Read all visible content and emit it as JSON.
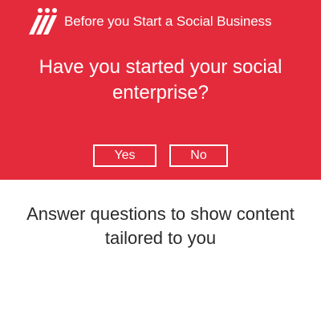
{
  "colors": {
    "banner_background": "#e42b3c",
    "banner_text": "#ffffff",
    "body_text": "#2a2a2a",
    "page_background": "#ffffff"
  },
  "header": {
    "logo_icon": "brand-stripes-logo",
    "title": "Before you Start a Social Business"
  },
  "prompt": {
    "question": "Have you started your social enterprise?",
    "answers": {
      "yes": "Yes",
      "no": "No"
    }
  },
  "footer": {
    "tagline": "Answer questions to show content tailored to you"
  }
}
